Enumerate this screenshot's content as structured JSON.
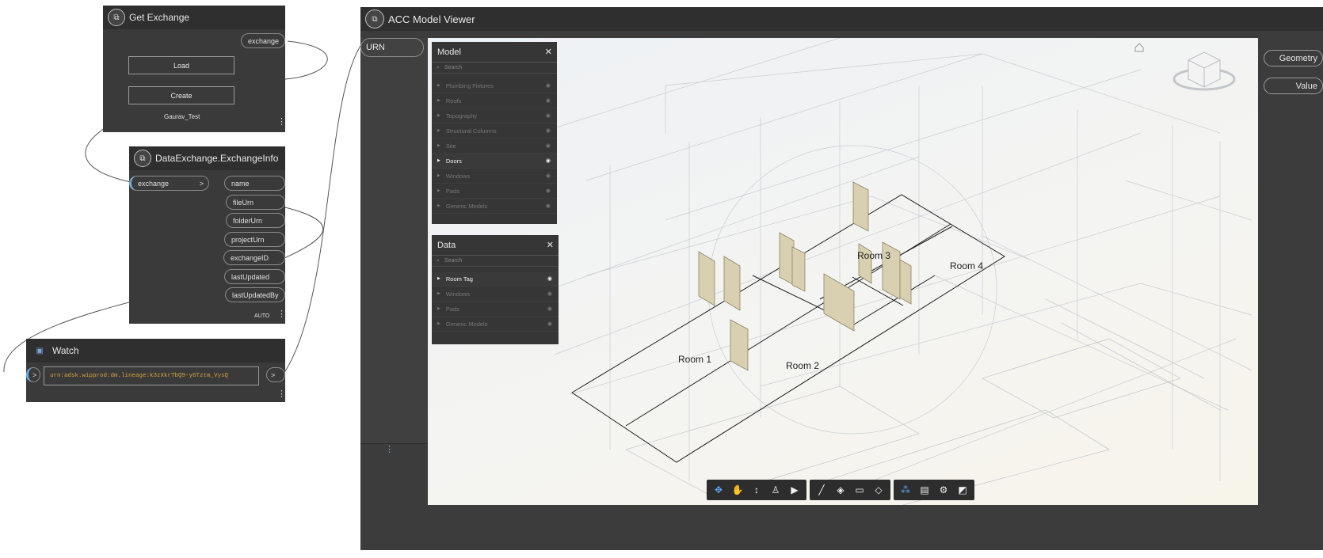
{
  "get_exchange": {
    "title": "Get Exchange",
    "output_port": "exchange",
    "load_label": "Load",
    "create_label": "Create",
    "user_name": "Gaurav_Test"
  },
  "exchange_info": {
    "title": "DataExchange.ExchangeInfo",
    "input_port": "exchange",
    "input_arrow": ">",
    "outputs": [
      "name",
      "fileUrn",
      "folderUrn",
      "projectUrn",
      "exchangeID",
      "lastUpdated",
      "lastUpdatedBy"
    ],
    "lacing": "AUTO"
  },
  "watch": {
    "title": "Watch",
    "value": "urn:adsk.wipprod:dm.lineage:k3zXkrTbQ9-y6Tztm_VysQ",
    "in_arrow": ">",
    "out_arrow": ">"
  },
  "acc_viewer": {
    "title": "ACC Model Viewer",
    "input_port": "URN",
    "outputs": [
      "Geometry",
      "Value"
    ]
  },
  "model_panel": {
    "title": "Model",
    "search_placeholder": "Search",
    "items": [
      {
        "label": "Plumbing Fixtures",
        "active": false
      },
      {
        "label": "Roofs",
        "active": false
      },
      {
        "label": "Topography",
        "active": false
      },
      {
        "label": "Structural Columns",
        "active": false
      },
      {
        "label": "Site",
        "active": false
      },
      {
        "label": "Doors",
        "active": true
      },
      {
        "label": "Windows",
        "active": false
      },
      {
        "label": "Pads",
        "active": false
      },
      {
        "label": "Generic Models",
        "active": false
      }
    ]
  },
  "data_panel": {
    "title": "Data",
    "search_placeholder": "Search",
    "items": [
      {
        "label": "Room Tag",
        "active": true
      },
      {
        "label": "Windows",
        "active": false
      },
      {
        "label": "Pads",
        "active": false
      },
      {
        "label": "Generic Models",
        "active": false
      }
    ]
  },
  "rooms": [
    "Room 1",
    "Room 2",
    "Room 3",
    "Room 4"
  ],
  "toolbar": {
    "groups": [
      [
        "orbit-icon",
        "pan-icon",
        "dolly-icon",
        "walk-icon",
        "camera-icon"
      ],
      [
        "measure-icon",
        "section-icon",
        "explode-icon",
        "model-box-icon"
      ],
      [
        "model-browser-icon",
        "properties-icon",
        "settings-icon",
        "fullscreen-icon"
      ]
    ]
  },
  "colors": {
    "node_bg": "#3a3a3a",
    "node_header": "#2f2f2f",
    "watch_text": "#d9a441",
    "active_tool": "#5aa9f4"
  }
}
